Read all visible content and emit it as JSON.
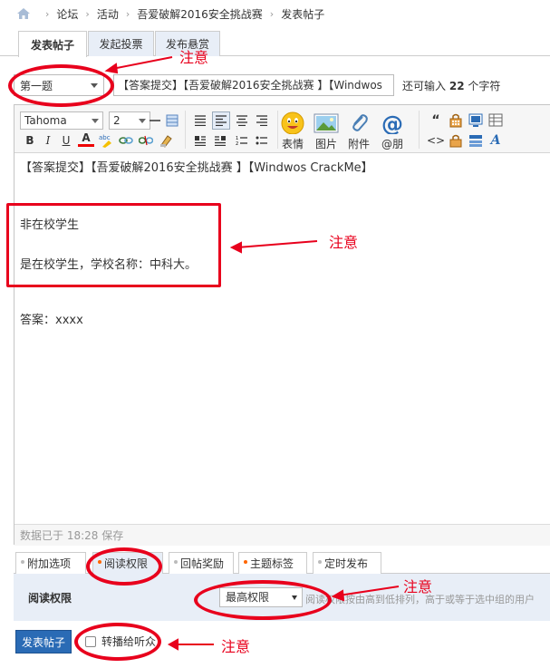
{
  "breadcrumb": {
    "items": [
      "论坛",
      "活动",
      "吾爱破解2016安全挑战赛",
      "发表帖子"
    ]
  },
  "top_tabs": [
    "发表帖子",
    "发起投票",
    "发布悬赏"
  ],
  "subject": {
    "type_value": "第一题",
    "title_value": "【答案提交】【吾爱破解2016安全挑战赛 】【Windwos",
    "hint_prefix": "还可输入",
    "hint_count": "22",
    "hint_suffix": "个字符"
  },
  "toolbar": {
    "font": "Tahoma",
    "size": "2",
    "bold": "B",
    "italic": "I",
    "underline": "U",
    "fontcolor": "A",
    "emoji_label": "表情",
    "image_label": "图片",
    "attach_label": "附件",
    "at_label": "@朋"
  },
  "content": {
    "line1": "【答案提交】【吾爱破解2016安全挑战赛 】【Windwos CrackMe】",
    "line2": "非在校学生",
    "line3": "是在校学生，学校名称：中科大。",
    "line4": "答案：xxxx"
  },
  "status": "数据已于 18:28 保存",
  "bottom_tabs": [
    "附加选项",
    "阅读权限",
    "回帖奖励",
    "主题标签",
    "定时发布"
  ],
  "permission": {
    "label": "阅读权限",
    "value": "最高权限",
    "hint": "阅读权限按由高到低排列，高于或等于选中组的用户"
  },
  "submit": {
    "label": "发表帖子",
    "broadcast_label": "转播给听众"
  },
  "annotations": {
    "note": "注意"
  },
  "colors": {
    "annotation": "#e8001c",
    "submit_bg": "#2a6bb5",
    "tab_bg": "#e8eef7"
  }
}
